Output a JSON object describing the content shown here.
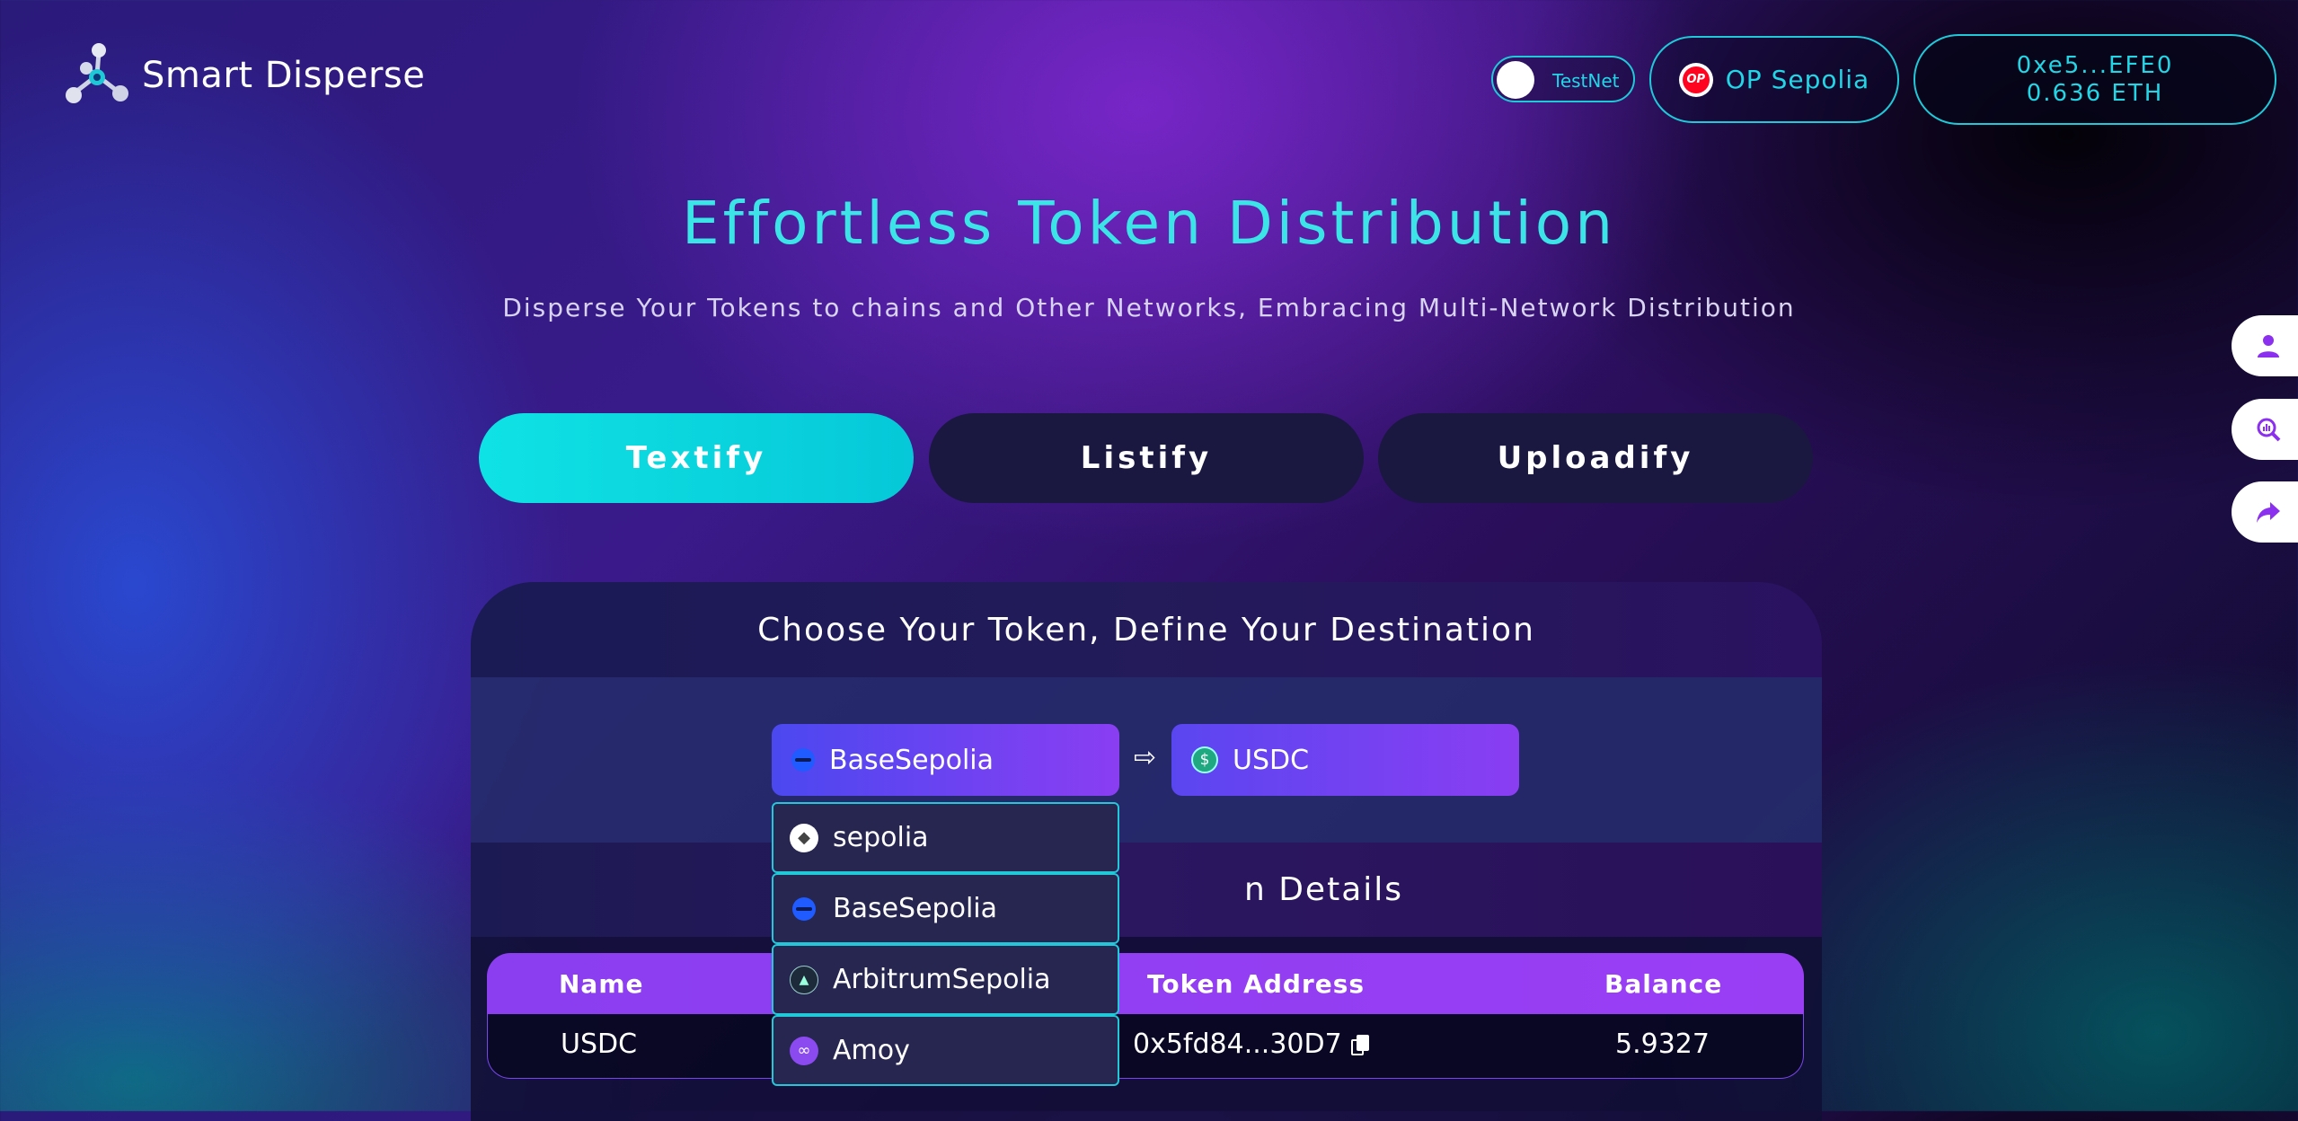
{
  "header": {
    "logo_text": "Smart Disperse",
    "toggle_label": "TestNet",
    "network_label": "OP Sepolia",
    "network_badge": "OP",
    "wallet_address": "0xe5...EFE0",
    "wallet_balance": "0.636 ETH"
  },
  "hero": {
    "title": "Effortless Token Distribution",
    "subtitle": "Disperse Your Tokens to chains and Other Networks, Embracing Multi-Network Distribution"
  },
  "tabs": [
    {
      "label": "Textify",
      "active": true
    },
    {
      "label": "Listify",
      "active": false
    },
    {
      "label": "Uploadify",
      "active": false
    }
  ],
  "panel": {
    "heading": "Choose Your Token, Define Your Destination",
    "selected_chain": "BaseSepolia",
    "arrow": "⇨",
    "selected_token": "USDC",
    "details_heading_visible": "n Details"
  },
  "dropdown": {
    "options": [
      {
        "label": "sepolia",
        "icon": "ethereum-icon"
      },
      {
        "label": "BaseSepolia",
        "icon": "base-icon"
      },
      {
        "label": "ArbitrumSepolia",
        "icon": "arbitrum-icon"
      },
      {
        "label": "Amoy",
        "icon": "polygon-icon"
      }
    ]
  },
  "table": {
    "headers": [
      "Name",
      "Token Address",
      "Balance"
    ],
    "rows": [
      {
        "name": "USDC",
        "address": "0x5fd84...30D7",
        "balance": "5.9327"
      }
    ]
  },
  "side_actions": [
    "user-icon",
    "analytics-icon",
    "share-icon"
  ],
  "colors": {
    "accent_cyan": "#22d6e6",
    "accent_purple": "#8a3ef0"
  }
}
